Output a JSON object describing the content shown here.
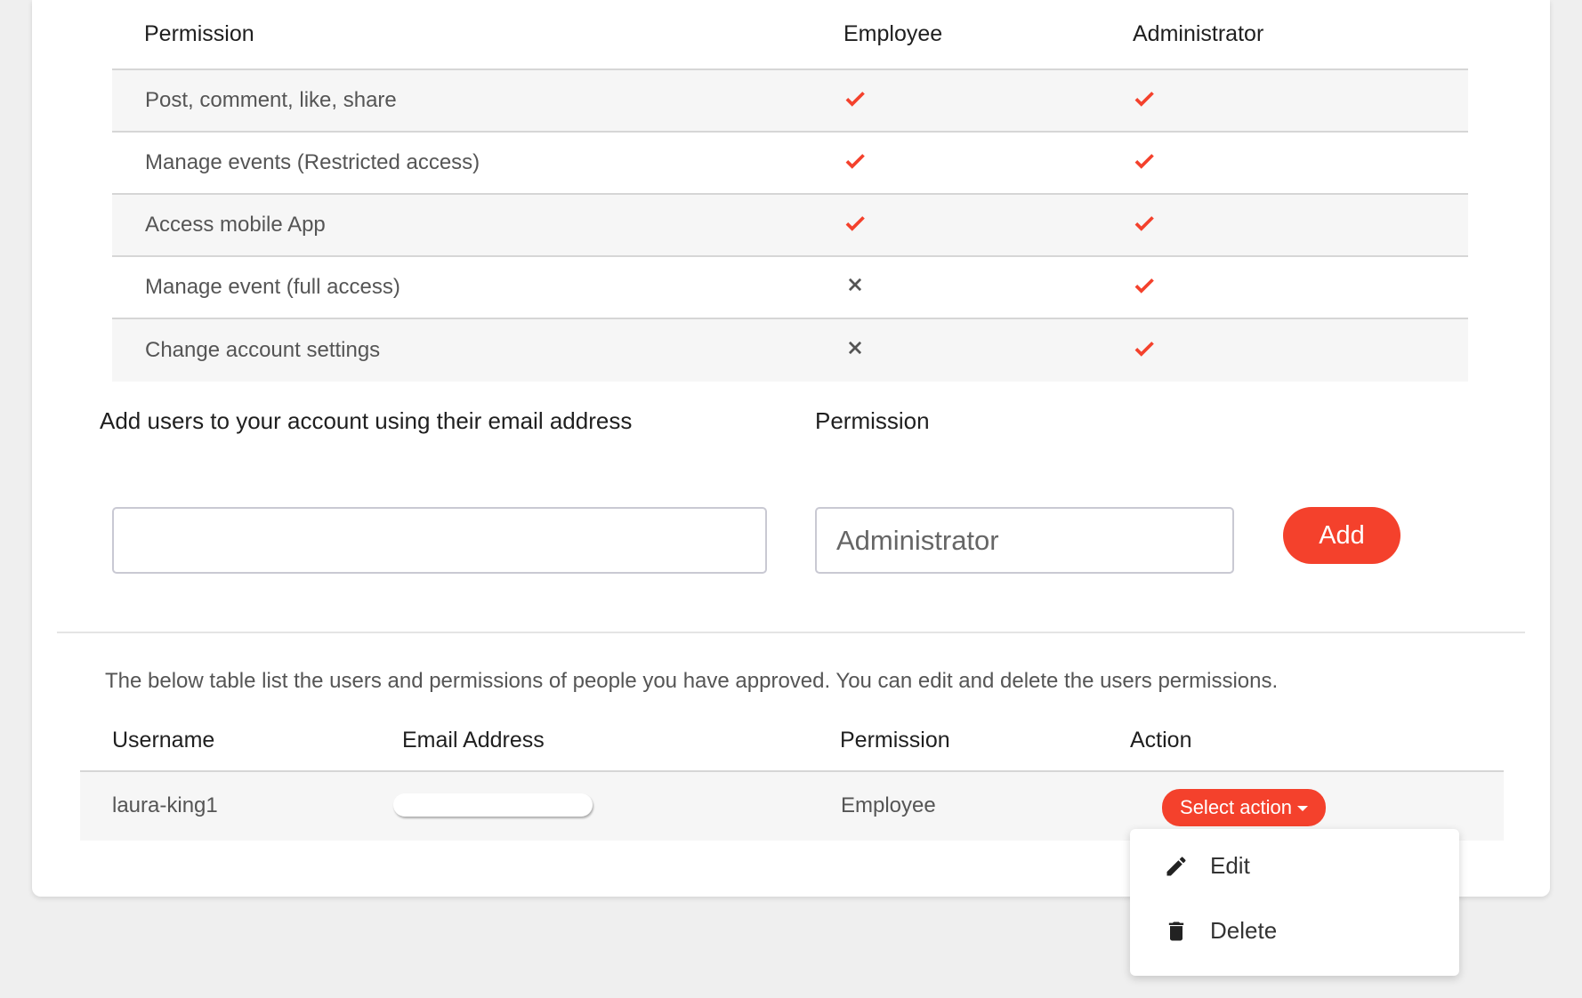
{
  "permissions_table": {
    "headers": {
      "permission": "Permission",
      "employee": "Employee",
      "administrator": "Administrator"
    },
    "rows": [
      {
        "label": "Post, comment, like, share",
        "employee": "check",
        "administrator": "check"
      },
      {
        "label": "Manage events (Restricted access)",
        "employee": "check",
        "administrator": "check"
      },
      {
        "label": "Access mobile App",
        "employee": "check",
        "administrator": "check"
      },
      {
        "label": "Manage event (full access)",
        "employee": "cross",
        "administrator": "check"
      },
      {
        "label": "Change account settings",
        "employee": "cross",
        "administrator": "check"
      }
    ]
  },
  "add_user_form": {
    "email_label": "Add users to your account using their email address",
    "email_value": "",
    "permission_label": "Permission",
    "permission_value": "Administrator",
    "add_button": "Add"
  },
  "users_section": {
    "intro": "The below table list the users and permissions of people you have approved. You can edit and delete the users permissions.",
    "headers": {
      "username": "Username",
      "email": "Email Address",
      "permission": "Permission",
      "action": "Action"
    },
    "rows": [
      {
        "username": "laura-king1",
        "email": "",
        "permission": "Employee",
        "action_label": "Select action"
      }
    ]
  },
  "action_menu": {
    "items": [
      {
        "label": "Edit",
        "icon": "pencil-icon"
      },
      {
        "label": "Delete",
        "icon": "trash-icon"
      }
    ]
  },
  "colors": {
    "accent": "#f4412c",
    "cross": "#555555"
  }
}
